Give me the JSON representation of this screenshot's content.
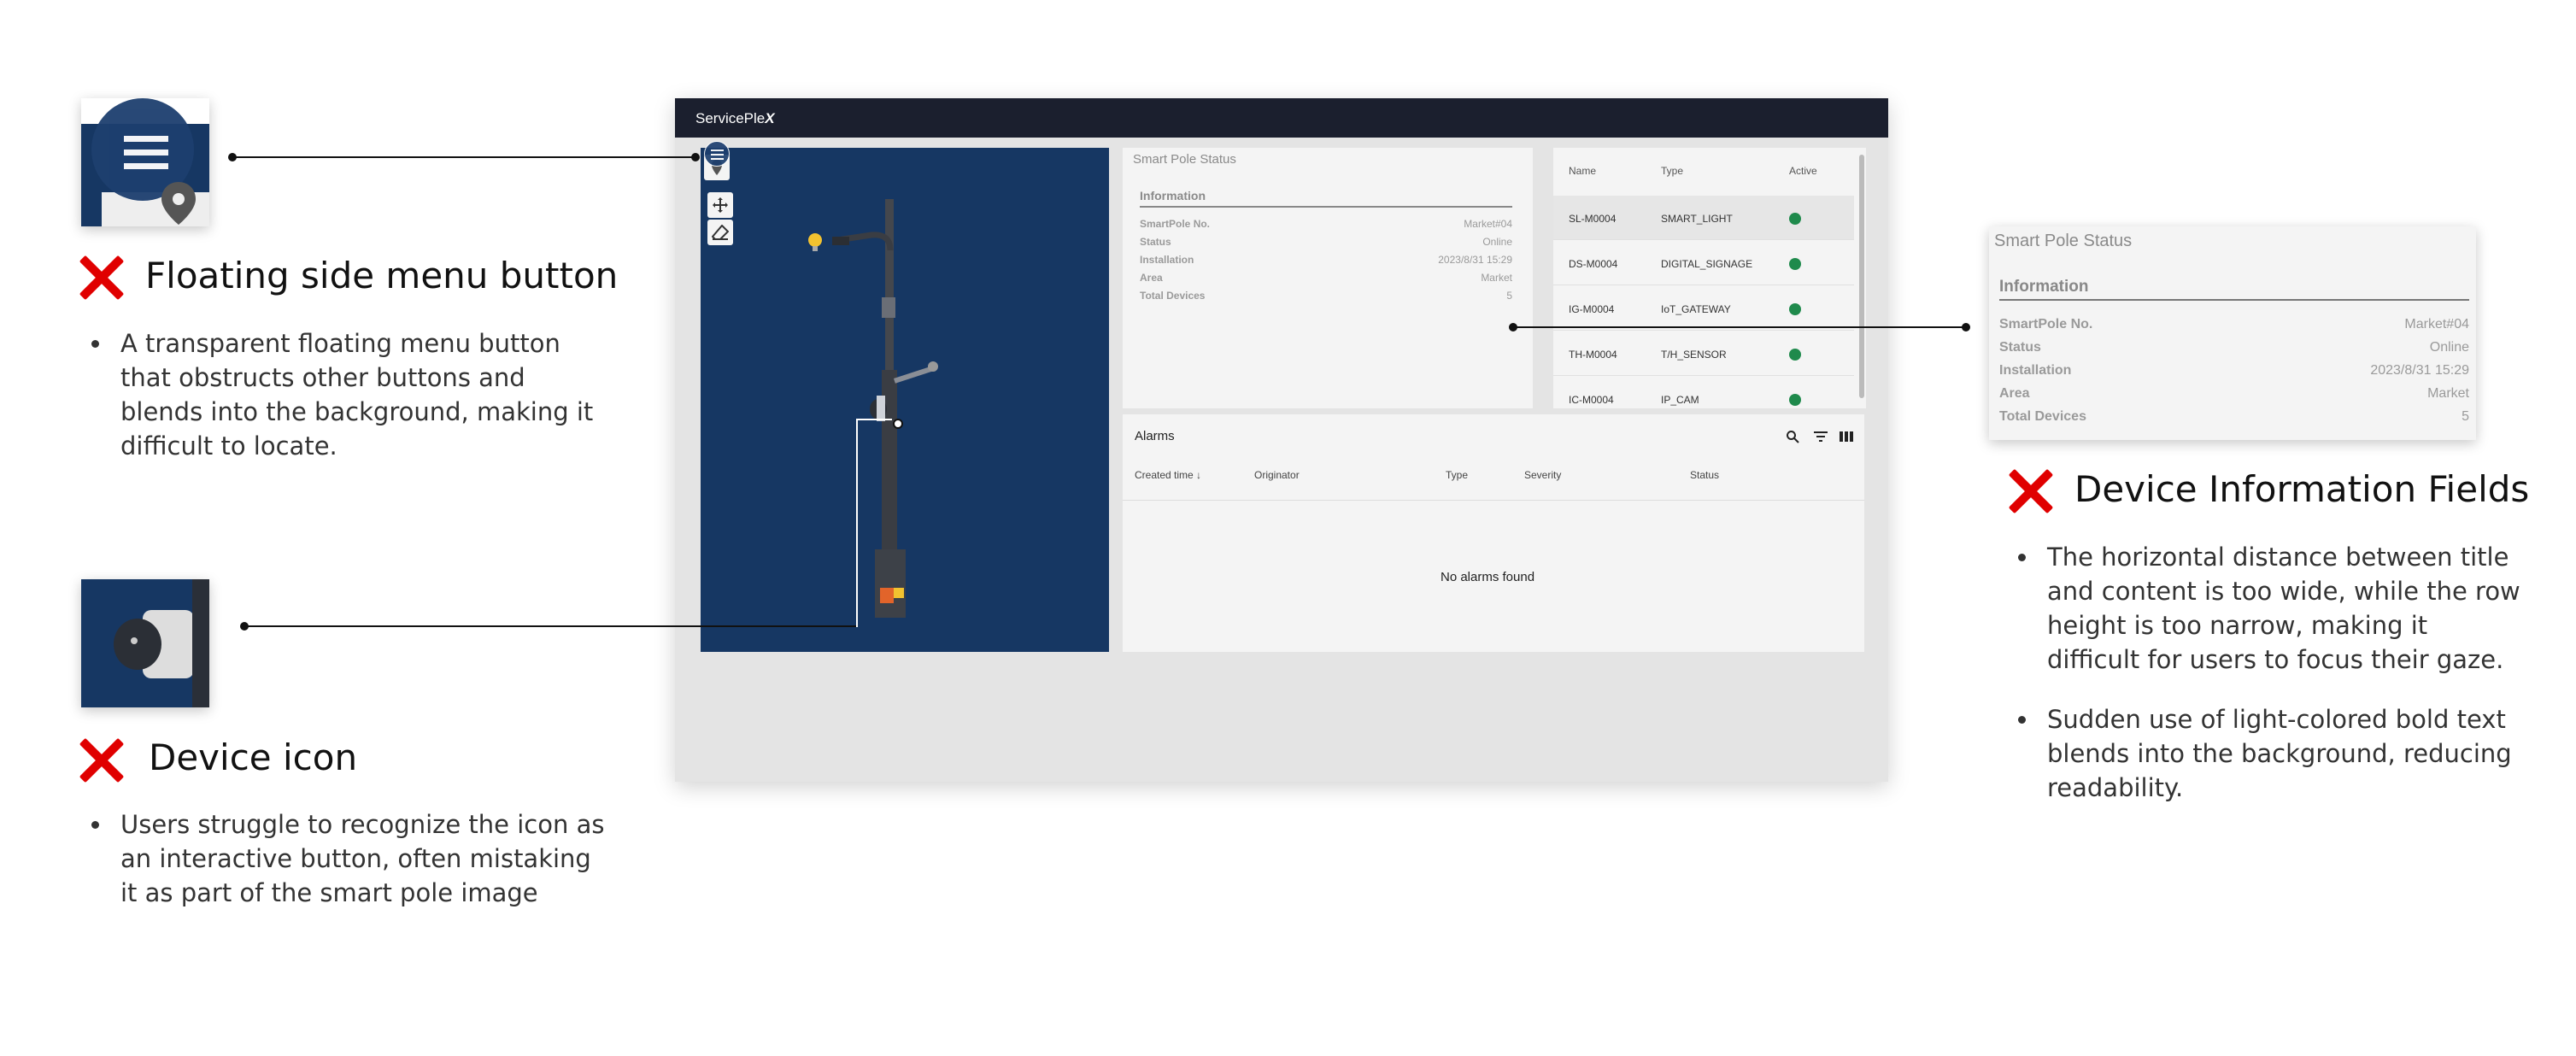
{
  "annotations": {
    "floating_menu": {
      "title": "Floating side menu button",
      "bullets": [
        "A transparent floating menu button that obstructs other buttons and blends into the background, making it difficult to locate."
      ]
    },
    "device_icon": {
      "title": "Device icon",
      "bullets": [
        "Users struggle to recognize the icon as an interactive button, often mistaking it as part of the smart pole image"
      ]
    },
    "device_info": {
      "title": "Device Information Fields",
      "bullets": [
        "The horizontal distance between title and content is too wide, while the row height is too narrow, making it difficult for users to focus their gaze.",
        "Sudden use of light-colored bold text blends into the background, reducing readability."
      ]
    }
  },
  "app": {
    "brand": "ServicePle",
    "brand_suffix": "X",
    "status_panel": {
      "title": "Smart Pole Status",
      "section": "Information",
      "rows": [
        {
          "label": "SmartPole No.",
          "value": "Market#04"
        },
        {
          "label": "Status",
          "value": "Online"
        },
        {
          "label": "Installation",
          "value": "2023/8/31 15:29"
        },
        {
          "label": "Area",
          "value": "Market"
        },
        {
          "label": "Total Devices",
          "value": "5"
        }
      ]
    },
    "devices": {
      "headers": {
        "name": "Name",
        "type": "Type",
        "active": "Active"
      },
      "rows": [
        {
          "name": "SL-M0004",
          "type": "SMART_LIGHT"
        },
        {
          "name": "DS-M0004",
          "type": "DIGITAL_SIGNAGE"
        },
        {
          "name": "IG-M0004",
          "type": "IoT_GATEWAY"
        },
        {
          "name": "TH-M0004",
          "type": "T/H_SENSOR"
        },
        {
          "name": "IC-M0004",
          "type": "IP_CAM"
        }
      ],
      "active_color": "#1f8a4c"
    },
    "alarms": {
      "title": "Alarms",
      "columns": {
        "created": "Created time",
        "originator": "Originator",
        "type": "Type",
        "severity": "Severity",
        "status": "Status"
      },
      "empty": "No alarms found"
    }
  },
  "colors": {
    "map_bg": "#163763",
    "appbar": "#1b1f2e",
    "x_mark": "#e00000"
  }
}
